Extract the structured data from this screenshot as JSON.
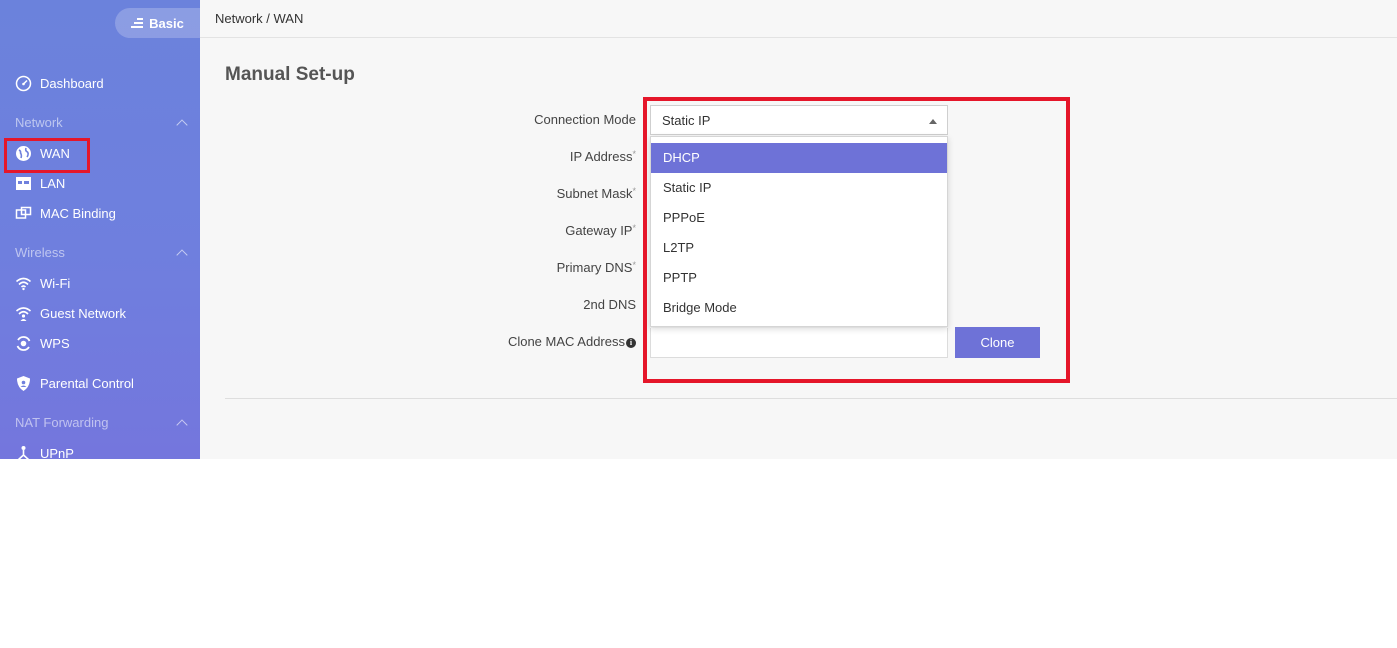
{
  "sidebar": {
    "mode_button": "Basic",
    "dashboard": "Dashboard",
    "sections": {
      "network": "Network",
      "wireless": "Wireless",
      "nat": "NAT Forwarding"
    },
    "items": {
      "wan": "WAN",
      "lan": "LAN",
      "mac_binding": "MAC Binding",
      "wifi": "Wi-Fi",
      "guest_network": "Guest Network",
      "wps": "WPS",
      "parental_control": "Parental Control",
      "upnp": "UPnP"
    }
  },
  "breadcrumb": "Network / WAN",
  "page_title": "Manual Set-up",
  "form": {
    "connection_mode_label": "Connection Mode",
    "ip_address_label": "IP Address",
    "subnet_mask_label": "Subnet Mask",
    "gateway_ip_label": "Gateway IP",
    "primary_dns_label": "Primary DNS",
    "second_dns_label": "2nd DNS",
    "clone_mac_label": "Clone MAC Address",
    "required_mark": "*",
    "info_mark": "i",
    "selected_mode": "Static IP",
    "mode_options": [
      "DHCP",
      "Static IP",
      "PPPoE",
      "L2TP",
      "PPTP",
      "Bridge Mode"
    ],
    "highlighted_option": "DHCP",
    "clone_button": "Clone"
  },
  "colors": {
    "accent": "#6e72d7",
    "sidebar_gradient_top": "#6b82dc",
    "highlight_border": "#e5162a"
  }
}
